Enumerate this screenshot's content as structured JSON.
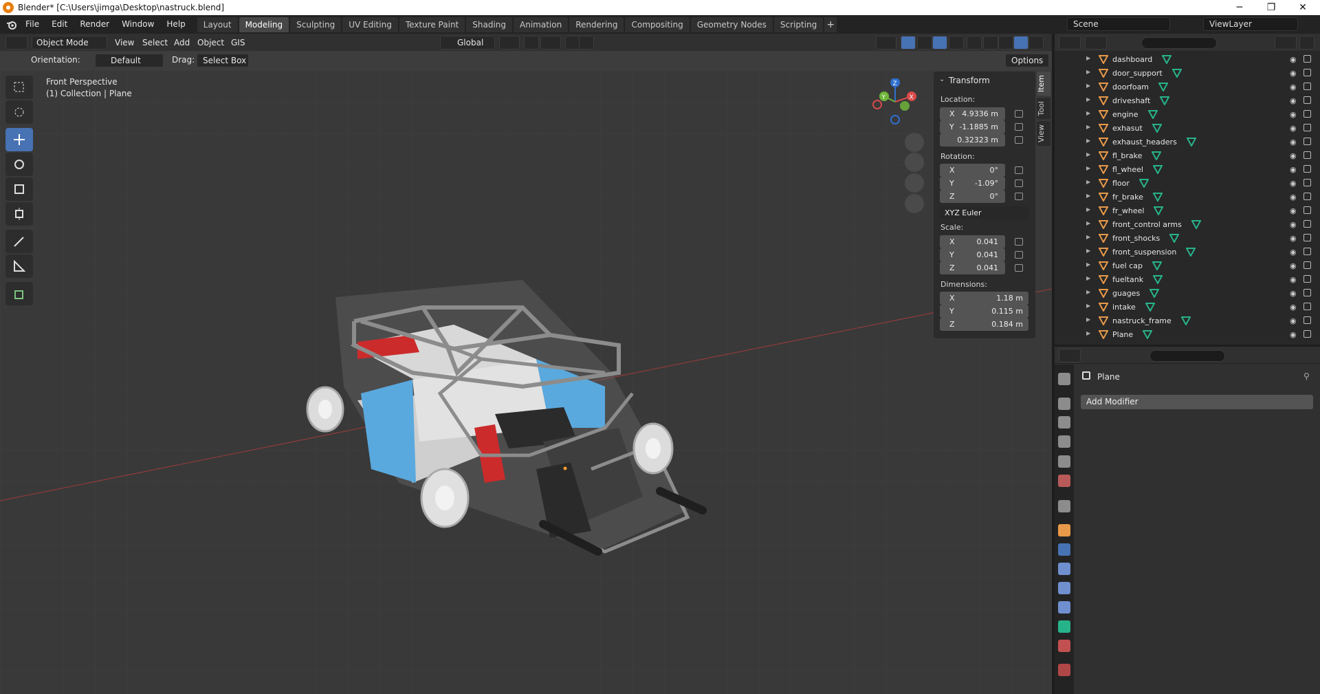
{
  "window": {
    "title": "Blender* [C:\\Users\\jimga\\Desktop\\nastruck.blend]",
    "minimize": "─",
    "maximize": "❐",
    "close": "✕"
  },
  "menu": [
    "File",
    "Edit",
    "Render",
    "Window",
    "Help"
  ],
  "workspaces": [
    "Layout",
    "Modeling",
    "Sculpting",
    "UV Editing",
    "Texture Paint",
    "Shading",
    "Animation",
    "Rendering",
    "Compositing",
    "Geometry Nodes",
    "Scripting"
  ],
  "active_workspace": "Modeling",
  "add_workspace": "+",
  "scene": "Scene",
  "view_layer": "ViewLayer",
  "viewport_header": {
    "mode": "Object Mode",
    "menus": [
      "View",
      "Select",
      "Add",
      "Object",
      "GIS"
    ],
    "transform_orientation": "Global"
  },
  "tool_settings": {
    "orientation_label": "Orientation:",
    "orientation_value": "Default",
    "drag_label": "Drag:",
    "drag_value": "Select Box",
    "options": "Options"
  },
  "viewport": {
    "view_name": "Front Perspective",
    "collection_info": "(1) Collection | Plane",
    "gizmo_axes": {
      "x": "X",
      "y": "Y",
      "z": "Z"
    }
  },
  "n_panel": {
    "title": "Transform",
    "location_label": "Location:",
    "location": [
      {
        "axis": "X",
        "value": "4.9336 m"
      },
      {
        "axis": "Y",
        "value": "-1.1885 m"
      },
      {
        "axis": "",
        "value": "0.32323 m"
      }
    ],
    "rotation_label": "Rotation:",
    "rotation": [
      {
        "axis": "X",
        "value": "0°"
      },
      {
        "axis": "Y",
        "value": "-1.09°"
      },
      {
        "axis": "Z",
        "value": "0°"
      }
    ],
    "rotation_mode": "XYZ Euler",
    "scale_label": "Scale:",
    "scale": [
      {
        "axis": "X",
        "value": "0.041"
      },
      {
        "axis": "Y",
        "value": "0.041"
      },
      {
        "axis": "Z",
        "value": "0.041"
      }
    ],
    "dimensions_label": "Dimensions:",
    "dimensions": [
      {
        "axis": "X",
        "value": "1.18 m"
      },
      {
        "axis": "Y",
        "value": "0.115 m"
      },
      {
        "axis": "Z",
        "value": "0.184 m"
      }
    ],
    "tabs": [
      "Item",
      "Tool",
      "View"
    ]
  },
  "outliner": {
    "items": [
      "dashboard",
      "door_support",
      "doorfoam",
      "driveshaft",
      "engine",
      "exhasut",
      "exhaust_headers",
      "fl_brake",
      "fl_wheel",
      "floor",
      "fr_brake",
      "fr_wheel",
      "front_control arms",
      "front_shocks",
      "front_suspension",
      "fuel cap",
      "fueltank",
      "guages",
      "intake",
      "nastruck_frame",
      "Plane"
    ]
  },
  "properties": {
    "object_name": "Plane",
    "add_modifier": "Add Modifier"
  },
  "colors": {
    "accent": "#4772b3",
    "viewport_bg": "#393939",
    "mesh_icon": "#e8994a",
    "modifier_icon": "#27b38a"
  }
}
